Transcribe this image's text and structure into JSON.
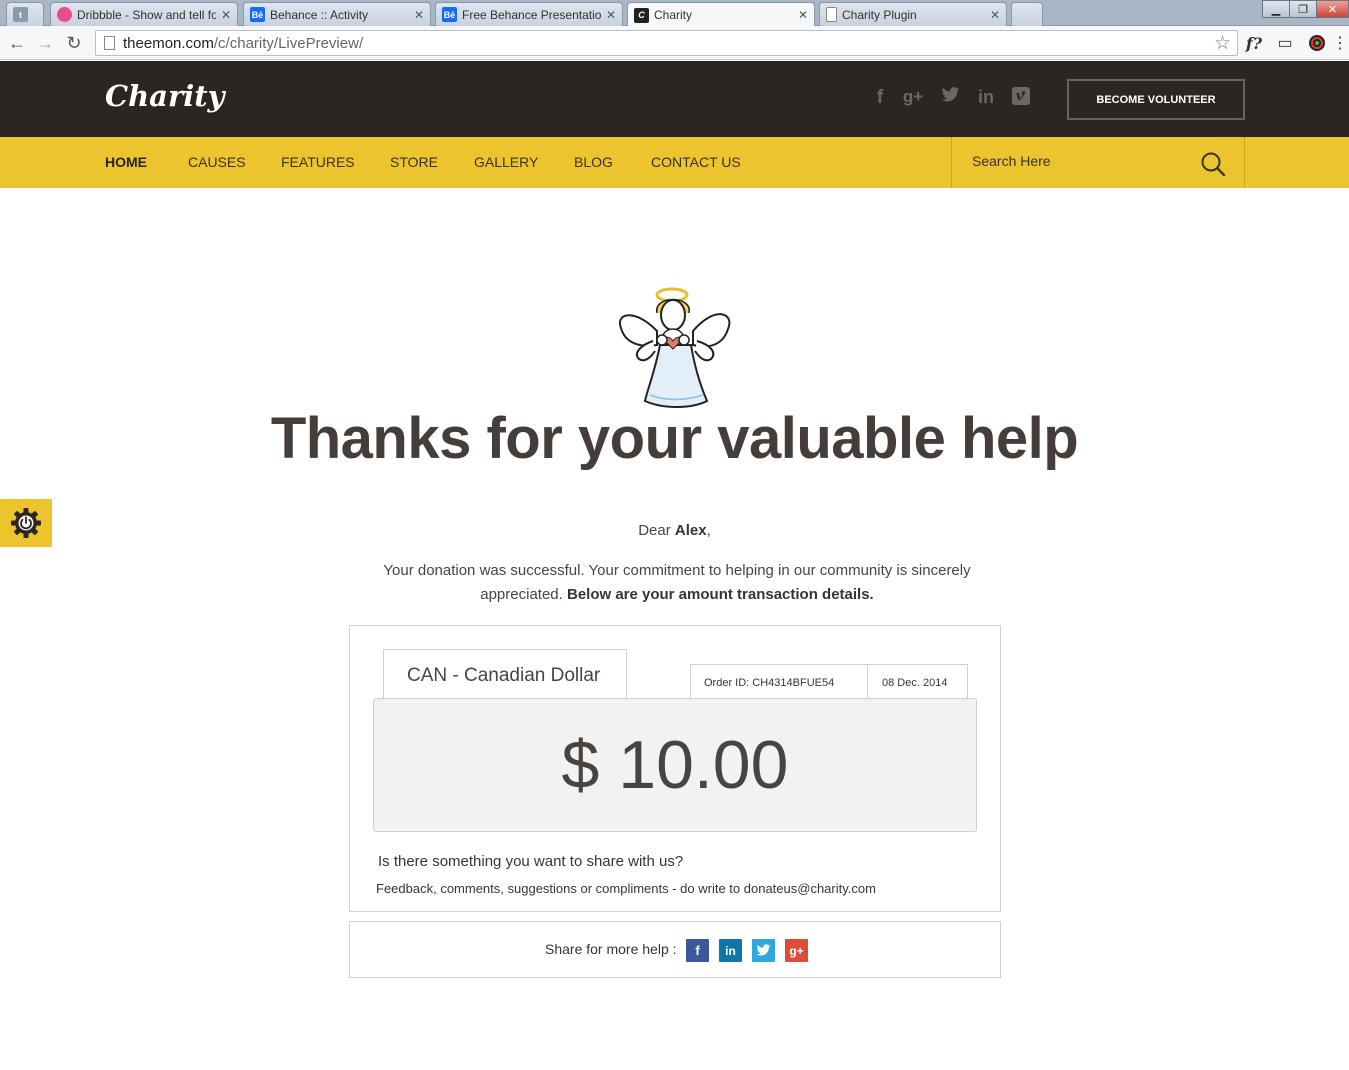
{
  "browser": {
    "tabs": [
      {
        "label": "",
        "favicon": "t",
        "color": "#8a9bb0"
      },
      {
        "label": "Dribbble - Show and tell fo",
        "favicon": "dribbble-icon",
        "color": "#ea4c89"
      },
      {
        "label": "Behance :: Activity",
        "favicon": "Bē",
        "color": "#1769ff"
      },
      {
        "label": "Free Behance Presentation",
        "favicon": "Bē",
        "color": "#1769ff"
      },
      {
        "label": "Charity",
        "favicon": "C",
        "color": "#222222"
      },
      {
        "label": "Charity Plugin",
        "favicon": "doc-icon",
        "color": "#888888"
      }
    ],
    "url_host": "theemon.com",
    "url_path": "/c/charity/LivePreview/"
  },
  "site": {
    "logo": "Charity",
    "volunteer_label": "BECOME VOLUNTEER",
    "nav": [
      "HOME",
      "CAUSES",
      "FEATURES",
      "STORE",
      "GALLERY",
      "BLOG",
      "CONTACT US"
    ],
    "search_placeholder": "Search Here",
    "social": [
      "facebook",
      "google-plus",
      "twitter",
      "linkedin",
      "vimeo"
    ]
  },
  "main": {
    "headline": "Thanks for your valuable help",
    "dear_prefix": "Dear ",
    "donor_name": "Alex",
    "dear_suffix": ",",
    "message": "Your donation was successful. Your commitment to helping  in our community is sincerely appreciated. ",
    "message_bold": "Below are your amount transaction details."
  },
  "receipt": {
    "currency": "CAN - Canadian Dollar",
    "order_id": "Order ID: CH4314BFUE54",
    "date": "08 Dec. 2014",
    "amount": "$ 10.00",
    "share_question": "Is there something you want to share with us?",
    "feedback": "Feedback, comments, suggestions or compliments - do write to donateus@charity.com"
  },
  "share": {
    "label": "Share for more help :",
    "networks": [
      {
        "name": "facebook",
        "glyph": "f",
        "color": "#3b5998"
      },
      {
        "name": "linkedin",
        "glyph": "in",
        "color": "#0e76a8"
      },
      {
        "name": "twitter",
        "glyph": "t",
        "color": "#2fa7de"
      },
      {
        "name": "google-plus",
        "glyph": "g+",
        "color": "#dd4b39"
      }
    ]
  }
}
